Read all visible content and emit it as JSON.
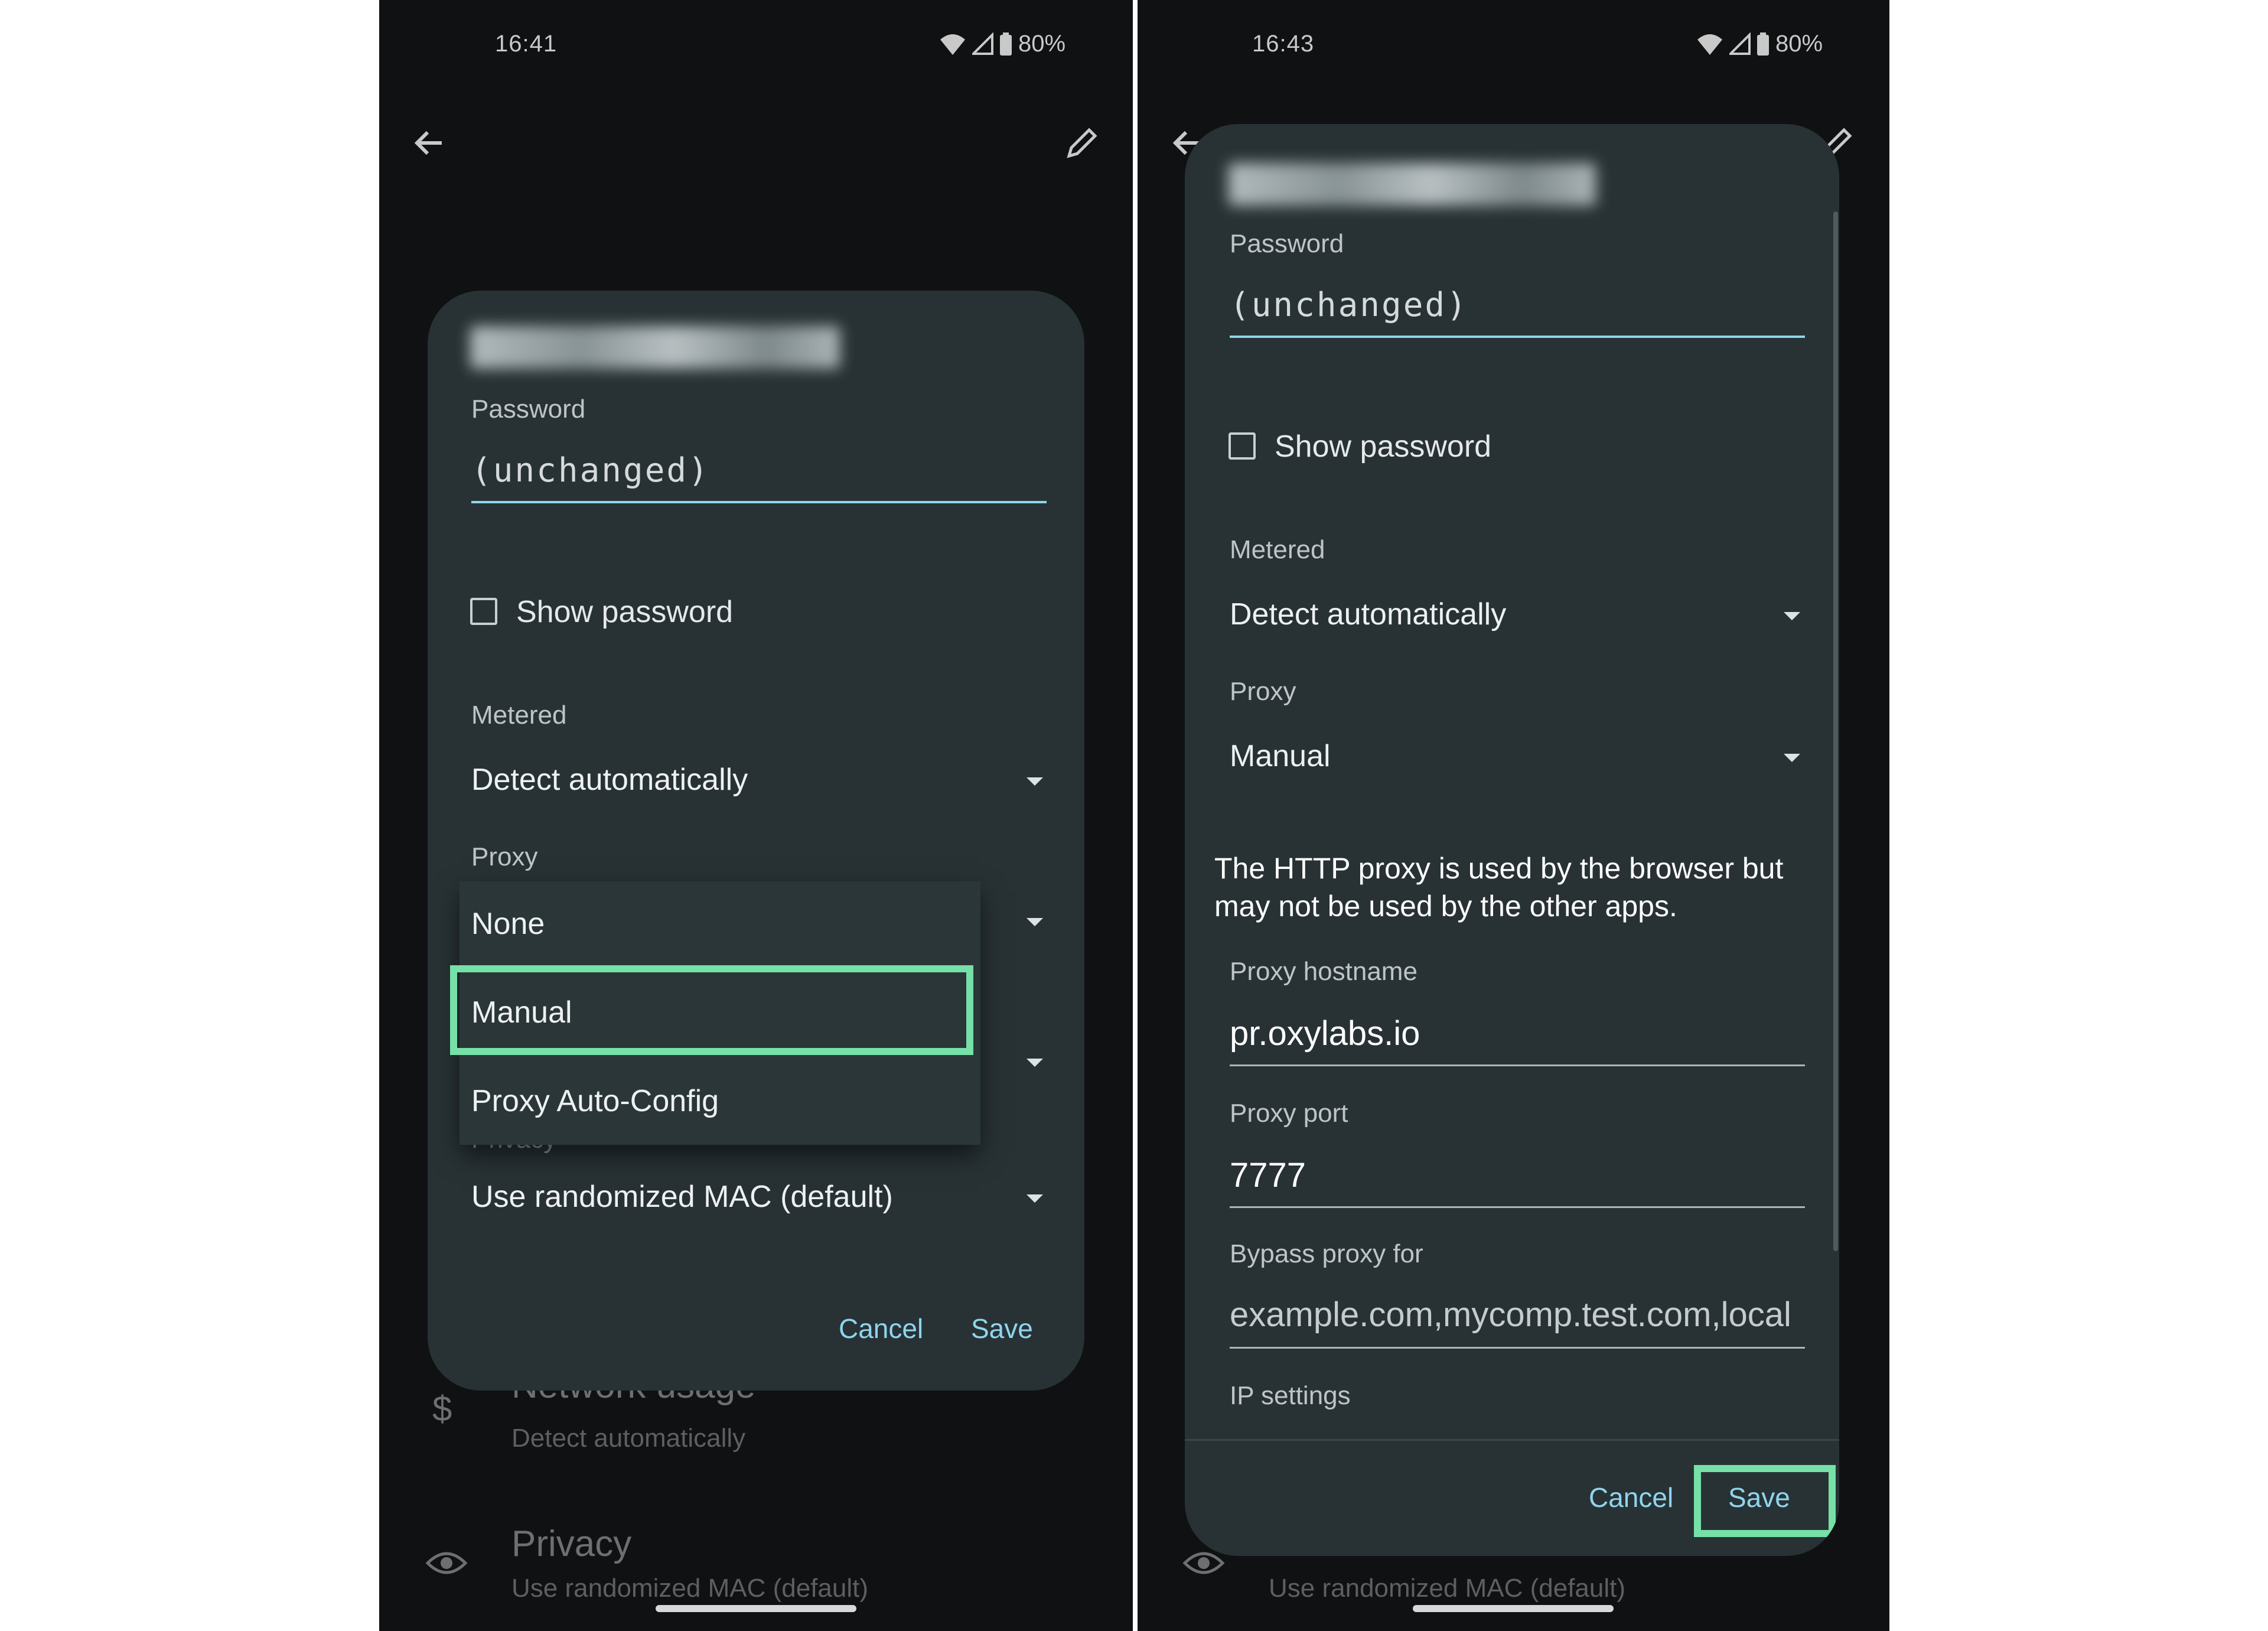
{
  "left": {
    "status": {
      "time": "16:41",
      "battery": "80%"
    },
    "dialog": {
      "password_label": "Password",
      "password_value": "(unchanged)",
      "show_password_label": "Show password",
      "metered_label": "Metered",
      "metered_value": "Detect automatically",
      "proxy_label": "Proxy",
      "proxy_options": [
        "None",
        "Manual",
        "Proxy Auto-Config"
      ],
      "proxy_highlighted": "Manual",
      "privacy_label_partial": "Privacy",
      "privacy_value": "Use randomized MAC (default)",
      "cancel": "Cancel",
      "save": "Save"
    },
    "background": {
      "network_usage_title": "Network usage",
      "network_usage_sub": "Detect automatically",
      "privacy_title": "Privacy",
      "privacy_sub": "Use randomized MAC (default)"
    }
  },
  "right": {
    "status": {
      "time": "16:43",
      "battery": "80%"
    },
    "dialog": {
      "password_label": "Password",
      "password_value": "(unchanged)",
      "show_password_label": "Show password",
      "metered_label": "Metered",
      "metered_value": "Detect automatically",
      "proxy_label": "Proxy",
      "proxy_value": "Manual",
      "proxy_note": "The HTTP proxy is used by the browser but may not be used by the other apps.",
      "hostname_label": "Proxy hostname",
      "hostname_value": "pr.oxylabs.io",
      "port_label": "Proxy port",
      "port_value": "7777",
      "bypass_label": "Bypass proxy for",
      "bypass_value": "example.com,mycomp.test.com,local",
      "ip_settings_label": "IP settings",
      "cancel": "Cancel",
      "save": "Save"
    },
    "background": {
      "privacy_sub": "Use randomized MAC (default)"
    }
  },
  "colors": {
    "highlight": "#76e0a8",
    "accent": "#8fd5ee",
    "dialog_bg": "#283235"
  },
  "icons": [
    "wifi-icon",
    "signal-icon",
    "battery-icon",
    "back-arrow-icon",
    "edit-pencil-icon",
    "dollar-icon",
    "privacy-eye-icon"
  ]
}
